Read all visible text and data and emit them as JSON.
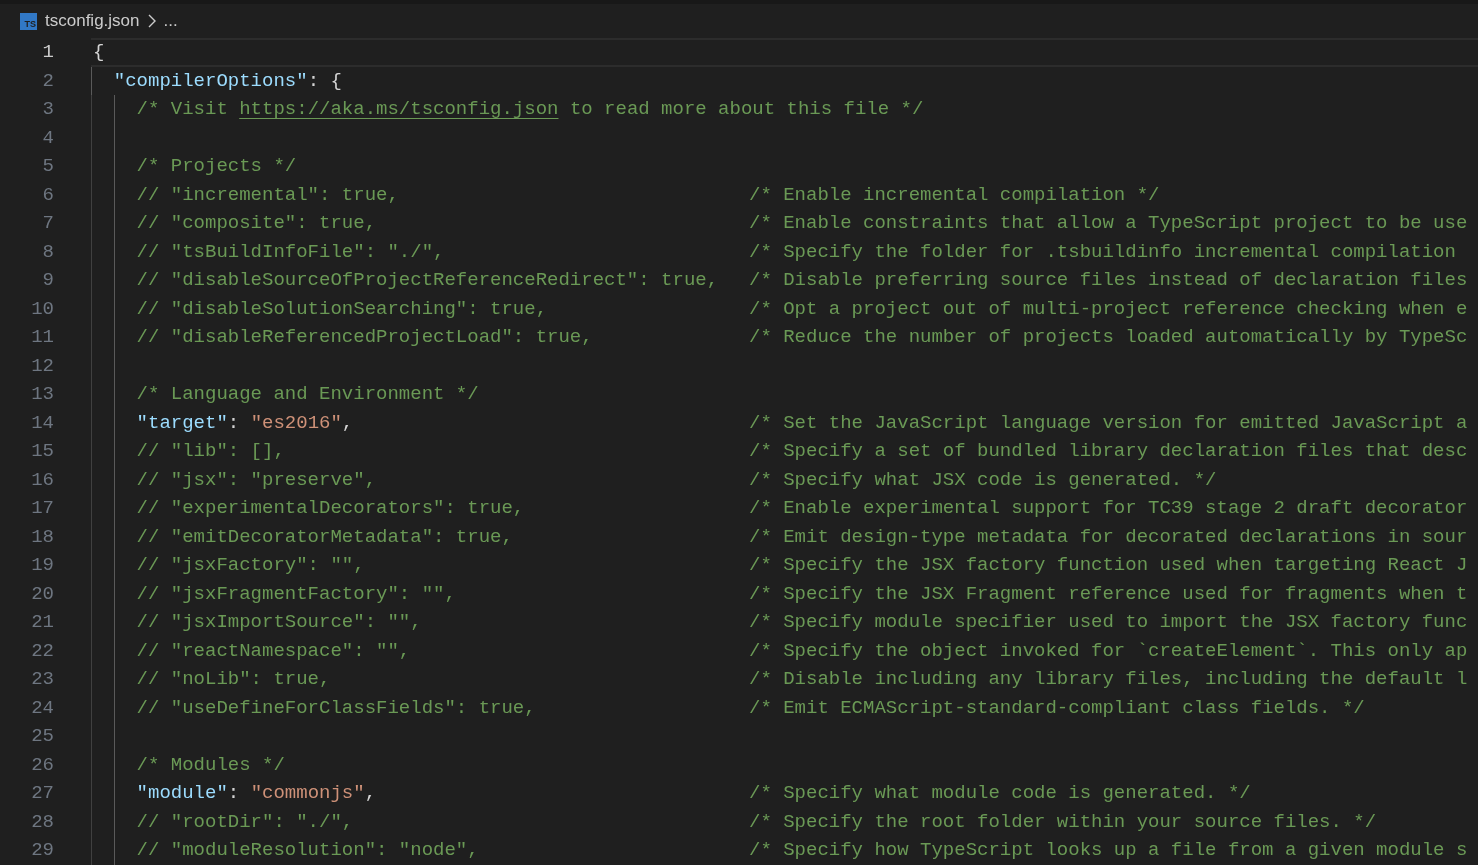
{
  "breadcrumb": {
    "icon_text": "TS",
    "file": "tsconfig.json",
    "more": "..."
  },
  "lines": [
    {
      "number": "1",
      "current": true,
      "tokens": [
        {
          "kind": "punct",
          "text": "{"
        }
      ],
      "children": [
        {
          "number": "2",
          "current": false,
          "tokens": [
            {
              "kind": "key",
              "text": "\"compilerOptions\""
            },
            {
              "kind": "punct",
              "text": ": {"
            }
          ],
          "children": [
            {
              "number": "3",
              "current": false,
              "tokens": [
                {
                  "kind": "comment",
                  "text": "/* Visit "
                },
                {
                  "kind": "link",
                  "text": "https://aka.ms/tsconfig.json"
                },
                {
                  "kind": "comment",
                  "text": " to read more about this file */"
                }
              ]
            },
            {
              "number": "4",
              "current": false
            },
            {
              "number": "5",
              "current": false,
              "tokens": [
                {
                  "kind": "comment",
                  "text": "/* Projects */"
                }
              ]
            },
            {
              "number": "6",
              "current": false,
              "tokens": [
                {
                  "kind": "comment",
                  "text": "// \"incremental\": true,"
                }
              ],
              "note": "/* Enable incremental compilation */"
            },
            {
              "number": "7",
              "current": false,
              "tokens": [
                {
                  "kind": "comment",
                  "text": "// \"composite\": true,"
                }
              ],
              "note": "/* Enable constraints that allow a TypeScript project to be use"
            },
            {
              "number": "8",
              "current": false,
              "tokens": [
                {
                  "kind": "comment",
                  "text": "// \"tsBuildInfoFile\": \"./\","
                }
              ],
              "note": "/* Specify the folder for .tsbuildinfo incremental compilation"
            },
            {
              "number": "9",
              "current": false,
              "tokens": [
                {
                  "kind": "comment",
                  "text": "// \"disableSourceOfProjectReferenceRedirect\": true,"
                }
              ],
              "note": "/* Disable preferring source files instead of declaration files"
            },
            {
              "number": "10",
              "current": false,
              "tokens": [
                {
                  "kind": "comment",
                  "text": "// \"disableSolutionSearching\": true,"
                }
              ],
              "note": "/* Opt a project out of multi-project reference checking when e"
            },
            {
              "number": "11",
              "current": false,
              "tokens": [
                {
                  "kind": "comment",
                  "text": "// \"disableReferencedProjectLoad\": true,"
                }
              ],
              "note": "/* Reduce the number of projects loaded automatically by TypeSc"
            },
            {
              "number": "12",
              "current": false
            },
            {
              "number": "13",
              "current": false,
              "tokens": [
                {
                  "kind": "comment",
                  "text": "/* Language and Environment */"
                }
              ]
            },
            {
              "number": "14",
              "current": false,
              "tokens": [
                {
                  "kind": "key",
                  "text": "\"target\""
                },
                {
                  "kind": "punct",
                  "text": ": "
                },
                {
                  "kind": "string",
                  "text": "\"es2016\""
                },
                {
                  "kind": "punct",
                  "text": ","
                }
              ],
              "note": "/* Set the JavaScript language version for emitted JavaScript a"
            },
            {
              "number": "15",
              "current": false,
              "tokens": [
                {
                  "kind": "comment",
                  "text": "// \"lib\": [],"
                }
              ],
              "note": "/* Specify a set of bundled library declaration files that desc"
            },
            {
              "number": "16",
              "current": false,
              "tokens": [
                {
                  "kind": "comment",
                  "text": "// \"jsx\": \"preserve\","
                }
              ],
              "note": "/* Specify what JSX code is generated. */"
            },
            {
              "number": "17",
              "current": false,
              "tokens": [
                {
                  "kind": "comment",
                  "text": "// \"experimentalDecorators\": true,"
                }
              ],
              "note": "/* Enable experimental support for TC39 stage 2 draft decorator"
            },
            {
              "number": "18",
              "current": false,
              "tokens": [
                {
                  "kind": "comment",
                  "text": "// \"emitDecoratorMetadata\": true,"
                }
              ],
              "note": "/* Emit design-type metadata for decorated declarations in sour"
            },
            {
              "number": "19",
              "current": false,
              "tokens": [
                {
                  "kind": "comment",
                  "text": "// \"jsxFactory\": \"\","
                }
              ],
              "note": "/* Specify the JSX factory function used when targeting React J"
            },
            {
              "number": "20",
              "current": false,
              "tokens": [
                {
                  "kind": "comment",
                  "text": "// \"jsxFragmentFactory\": \"\","
                }
              ],
              "note": "/* Specify the JSX Fragment reference used for fragments when t"
            },
            {
              "number": "21",
              "current": false,
              "tokens": [
                {
                  "kind": "comment",
                  "text": "// \"jsxImportSource\": \"\","
                }
              ],
              "note": "/* Specify module specifier used to import the JSX factory func"
            },
            {
              "number": "22",
              "current": false,
              "tokens": [
                {
                  "kind": "comment",
                  "text": "// \"reactNamespace\": \"\","
                }
              ],
              "note": "/* Specify the object invoked for `createElement`. This only ap"
            },
            {
              "number": "23",
              "current": false,
              "tokens": [
                {
                  "kind": "comment",
                  "text": "// \"noLib\": true,"
                }
              ],
              "note": "/* Disable including any library files, including the default l"
            },
            {
              "number": "24",
              "current": false,
              "tokens": [
                {
                  "kind": "comment",
                  "text": "// \"useDefineForClassFields\": true,"
                }
              ],
              "note": "/* Emit ECMAScript-standard-compliant class fields. */"
            },
            {
              "number": "25",
              "current": false
            },
            {
              "number": "26",
              "current": false,
              "tokens": [
                {
                  "kind": "comment",
                  "text": "/* Modules */"
                }
              ]
            },
            {
              "number": "27",
              "current": false,
              "tokens": [
                {
                  "kind": "key",
                  "text": "\"module\""
                },
                {
                  "kind": "punct",
                  "text": ": "
                },
                {
                  "kind": "string",
                  "text": "\"commonjs\""
                },
                {
                  "kind": "punct",
                  "text": ","
                }
              ],
              "note": "/* Specify what module code is generated. */"
            },
            {
              "number": "28",
              "current": false,
              "tokens": [
                {
                  "kind": "comment",
                  "text": "// \"rootDir\": \"./\","
                }
              ],
              "note": "/* Specify the root folder within your source files. */"
            },
            {
              "number": "29",
              "current": false,
              "tokens": [
                {
                  "kind": "comment",
                  "text": "// \"moduleResolution\": \"node\","
                }
              ],
              "note": "/* Specify how TypeScript looks up a file from a given module s"
            }
          ]
        }
      ]
    }
  ]
}
